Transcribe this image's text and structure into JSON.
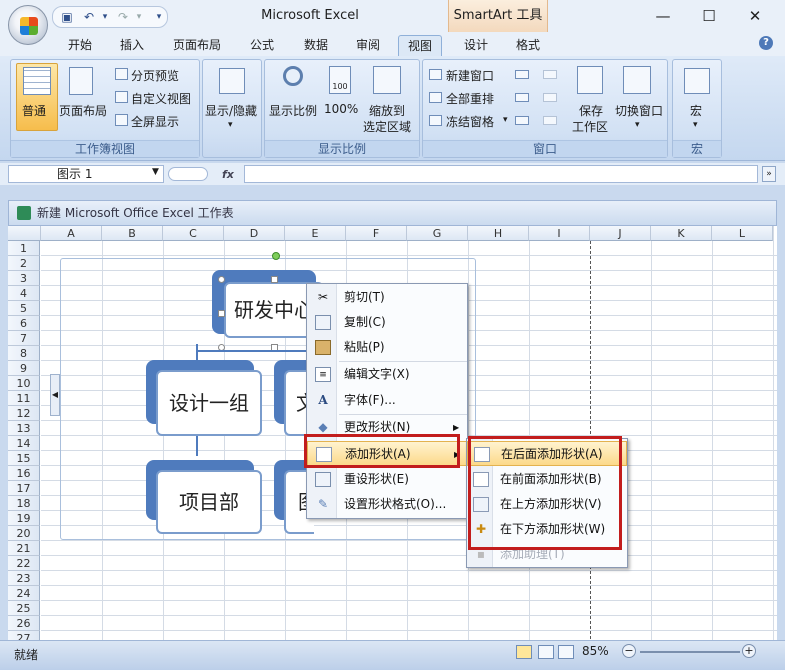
{
  "window": {
    "title": "Microsoft Excel",
    "context_tab": "SmartArt 工具",
    "minimize": "—",
    "maximize": "☐",
    "close": "✕"
  },
  "qat": {
    "save_icon": "save-icon",
    "undo_icon": "undo-icon",
    "redo_icon": "redo-icon",
    "customize_icon": "chevron-down-icon"
  },
  "tabs": [
    "开始",
    "插入",
    "页面布局",
    "公式",
    "数据",
    "审阅",
    "视图",
    "设计",
    "格式"
  ],
  "active_tab": "视图",
  "ribbon": {
    "workbook_views": {
      "label": "工作簿视图",
      "normal": "普通",
      "page_layout": "页面布局",
      "page_break": "分页预览",
      "custom_view": "自定义视图",
      "full_screen": "全屏显示"
    },
    "show_hide": {
      "label": "显示/隐藏"
    },
    "zoom": {
      "label": "显示比例",
      "zoom": "显示比例",
      "hundred": "100%",
      "zoom_sel_1": "缩放到",
      "zoom_sel_2": "选定区域"
    },
    "window": {
      "label": "窗口",
      "new_window": "新建窗口",
      "arrange_all": "全部重排",
      "freeze": "冻结窗格",
      "save_ws_1": "保存",
      "save_ws_2": "工作区",
      "switch": "切换窗口"
    },
    "macros": {
      "label": "宏",
      "macro": "宏"
    }
  },
  "formula_bar": {
    "name_box": "图示 1",
    "fx": "fx",
    "formula": ""
  },
  "workbook": {
    "title": "新建 Microsoft Office Excel 工作表"
  },
  "columns": [
    "A",
    "B",
    "C",
    "D",
    "E",
    "F",
    "G",
    "H",
    "I",
    "J",
    "K",
    "L"
  ],
  "rows": [
    "1",
    "2",
    "3",
    "4",
    "5",
    "6",
    "7",
    "8",
    "9",
    "10",
    "11",
    "12",
    "13",
    "14",
    "15",
    "16",
    "17",
    "18",
    "19",
    "20",
    "21",
    "22",
    "23",
    "24",
    "25",
    "26",
    "27"
  ],
  "smartart": {
    "top": "研发中心",
    "left_mid": "设计一组",
    "right_mid": "文",
    "left_bottom": "项目部",
    "right_bottom": "图"
  },
  "context_menu": [
    {
      "label": "剪切(T)",
      "icon": "scissors-icon"
    },
    {
      "label": "复制(C)",
      "icon": "copy-icon"
    },
    {
      "label": "粘贴(P)",
      "icon": "paste-icon"
    },
    {
      "label": "编辑文字(X)",
      "icon": "text-icon"
    },
    {
      "label": "字体(F)...",
      "icon": "font-icon"
    },
    {
      "label": "更改形状(N)",
      "icon": "shapes-icon"
    },
    {
      "label": "添加形状(A)",
      "icon": "add-shape-icon"
    },
    {
      "label": "重设形状(E)",
      "icon": "reset-shape-icon"
    },
    {
      "label": "设置形状格式(O)...",
      "icon": "format-shape-icon"
    }
  ],
  "submenu": [
    {
      "label": "在后面添加形状(A)"
    },
    {
      "label": "在前面添加形状(B)"
    },
    {
      "label": "在上方添加形状(V)"
    },
    {
      "label": "在下方添加形状(W)"
    },
    {
      "label": "添加助理(T)"
    }
  ],
  "status": {
    "ready": "就绪",
    "zoom": "85%"
  },
  "colors": {
    "highlight": "#c21d1d",
    "node": "#4f7bbd"
  }
}
